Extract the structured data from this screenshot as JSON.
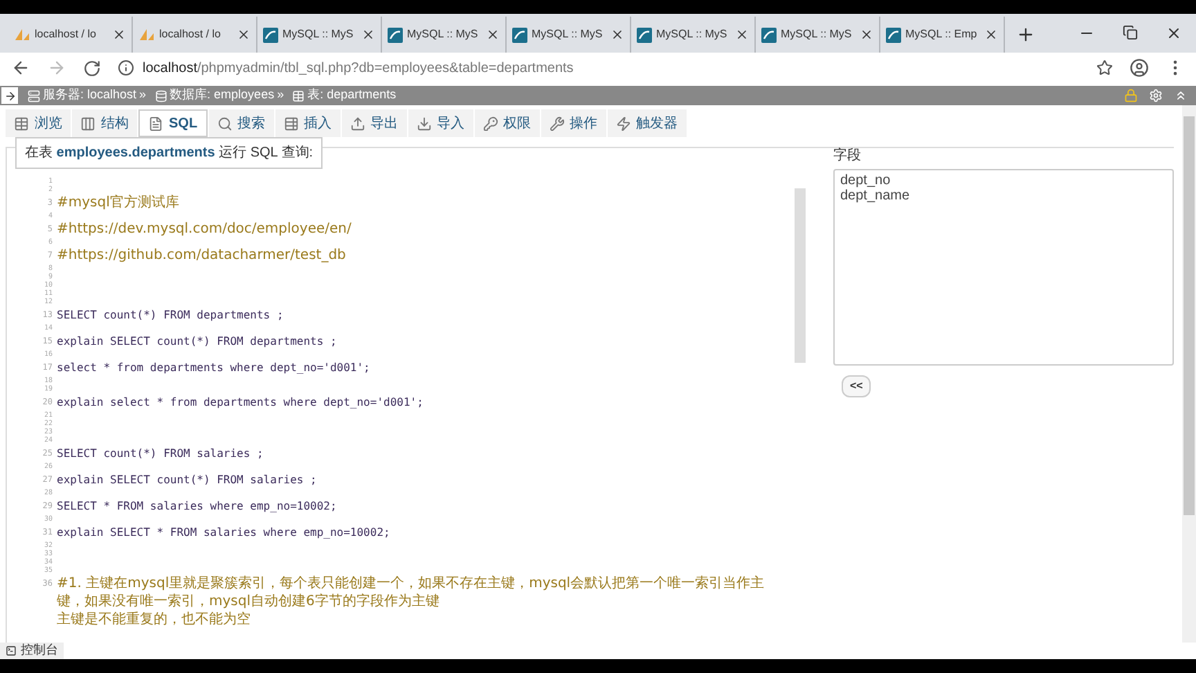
{
  "browser_tabs": [
    {
      "title": "localhost / lo",
      "kind": "pma",
      "selected": false
    },
    {
      "title": "localhost / lo",
      "kind": "pma",
      "selected": false
    },
    {
      "title": "MySQL :: MyS",
      "kind": "mysql",
      "selected": false
    },
    {
      "title": "MySQL :: MyS",
      "kind": "mysql",
      "selected": false
    },
    {
      "title": "MySQL :: MyS",
      "kind": "mysql",
      "selected": false
    },
    {
      "title": "MySQL :: MyS",
      "kind": "mysql",
      "selected": false
    },
    {
      "title": "MySQL :: MyS",
      "kind": "mysql",
      "selected": false
    },
    {
      "title": "MySQL :: Emp",
      "kind": "mysql",
      "selected": false
    }
  ],
  "address_bar": {
    "host": "localhost",
    "path": "/phpmyadmin/tbl_sql.php?db=employees&table=departments"
  },
  "breadcrumb": [
    {
      "label": "服务器: localhost",
      "kind": "server",
      "separator": "»"
    },
    {
      "label": "数据库: employees",
      "kind": "database",
      "separator": "»"
    },
    {
      "label": "表: departments",
      "kind": "table"
    }
  ],
  "toolbar": [
    {
      "label": "浏览",
      "kind": "browse",
      "selected": false
    },
    {
      "label": "结构",
      "kind": "structure",
      "selected": false
    },
    {
      "label": "SQL",
      "kind": "sql",
      "selected": true
    },
    {
      "label": "搜索",
      "kind": "search",
      "selected": false
    },
    {
      "label": "插入",
      "kind": "insert",
      "selected": false
    },
    {
      "label": "导出",
      "kind": "export",
      "selected": false
    },
    {
      "label": "导入",
      "kind": "import",
      "selected": false
    },
    {
      "label": "权限",
      "kind": "privileges",
      "selected": false
    },
    {
      "label": "操作",
      "kind": "operations",
      "selected": false
    },
    {
      "label": "触发器",
      "kind": "triggers",
      "selected": false
    }
  ],
  "query_panel": {
    "legend": "在表 **employees.departments** 运行 SQL 查询:",
    "lines": [
      {
        "number": "1"
      },
      {
        "number": "2"
      },
      {
        "number": "3",
        "kind": "comment",
        "text": "#mysql官方测试库"
      },
      {
        "number": "4"
      },
      {
        "number": "5",
        "kind": "comment",
        "text": "#https://dev.mysql.com/doc/employee/en/"
      },
      {
        "number": "6"
      },
      {
        "number": "7",
        "kind": "comment",
        "text": "#https://github.com/datacharmer/test_db"
      },
      {
        "number": "8"
      },
      {
        "number": "9"
      },
      {
        "number": "10"
      },
      {
        "number": "11"
      },
      {
        "number": "12"
      },
      {
        "number": "13",
        "kind": "code",
        "text": "SELECT count(*) FROM departments ;"
      },
      {
        "number": "14"
      },
      {
        "number": "15",
        "kind": "code",
        "text": "explain SELECT count(*) FROM departments ;"
      },
      {
        "number": "16"
      },
      {
        "number": "17",
        "kind": "code",
        "text": "select * from departments where dept_no='d001';"
      },
      {
        "number": "18"
      },
      {
        "number": "19"
      },
      {
        "number": "20",
        "kind": "code",
        "text": "explain select * from departments where dept_no='d001';"
      },
      {
        "number": "21"
      },
      {
        "number": "22"
      },
      {
        "number": "23"
      },
      {
        "number": "24"
      },
      {
        "number": "25",
        "kind": "code",
        "text": "SELECT count(*) FROM salaries ;"
      },
      {
        "number": "26"
      },
      {
        "number": "27",
        "kind": "code",
        "text": "explain SELECT count(*) FROM salaries ;"
      },
      {
        "number": "28"
      },
      {
        "number": "29",
        "kind": "code",
        "text": "SELECT * FROM salaries where emp_no=10002;"
      },
      {
        "number": "30"
      },
      {
        "number": "31",
        "kind": "code",
        "text": "explain SELECT * FROM salaries where emp_no=10002;"
      },
      {
        "number": "32"
      },
      {
        "number": "33"
      },
      {
        "number": "34"
      },
      {
        "number": "35"
      },
      {
        "number": "36",
        "kind": "comment",
        "text": "#1. 主键在mysql里就是聚簇索引，每个表只能创建一个，如果不存在主键，mysql会默认把第一个唯一索引当作主键，如果没有唯一索引，mysql自动创建6字节的字段作为主键"
      },
      {
        "kind": "comment",
        "text": "主键是不能重复的，也不能为空"
      }
    ]
  },
  "fields_panel": {
    "legend": "字段",
    "fields": [
      "dept_no",
      "dept_name"
    ],
    "insert_button": "<<"
  },
  "console": {
    "label": "控制台"
  }
}
